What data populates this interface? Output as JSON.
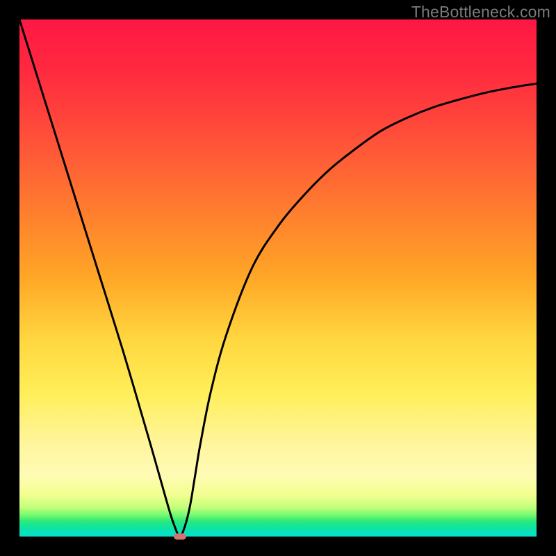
{
  "watermark": "TheBottleneck.com",
  "chart_data": {
    "type": "line",
    "title": "",
    "xlabel": "",
    "ylabel": "",
    "xlim": [
      0,
      100
    ],
    "ylim": [
      0,
      100
    ],
    "x": [
      0,
      5,
      10,
      15,
      20,
      25,
      27,
      29,
      30,
      31,
      32,
      33,
      34,
      35,
      37,
      40,
      45,
      50,
      55,
      60,
      65,
      70,
      75,
      80,
      85,
      90,
      95,
      100
    ],
    "y": [
      100,
      84,
      68,
      52,
      36,
      19,
      12,
      5,
      2,
      0,
      2,
      6,
      12,
      18,
      28,
      39,
      52,
      60,
      66,
      71,
      75,
      78.5,
      81,
      83,
      84.5,
      85.8,
      86.8,
      87.6
    ],
    "minimum": {
      "x": 31,
      "y": 0
    }
  },
  "colors": {
    "curve": "#000000",
    "marker": "#d1756e",
    "frame": "#000000"
  }
}
